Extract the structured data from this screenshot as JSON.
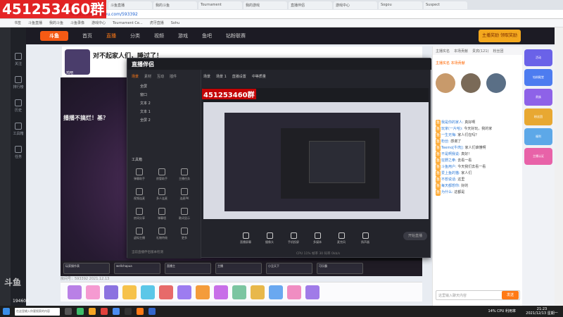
{
  "overlay_number": "451253460群",
  "browser": {
    "tabs": [
      "斗鱼",
      "斗鱼直播",
      "我的斗鱼",
      "Tournament",
      "我的游戏",
      "直播伴侣",
      "游戏中心",
      "Sogou",
      "Suspect"
    ],
    "url": "https://www.douyu.com/593392",
    "bookmarks": [
      "书签",
      "斗鱼直播",
      "我的斗鱼",
      "斗鱼录像",
      "游戏中心",
      "Tournament Ce...",
      "虎牙直播",
      "Sohu"
    ]
  },
  "sidebar": {
    "items": [
      "关注",
      "排行榜",
      "历史",
      "工具箱",
      "任务"
    ]
  },
  "topnav": {
    "logo": "斗鱼",
    "items": [
      "首页",
      "直播",
      "分类",
      "视频",
      "游戏",
      "鱼吧",
      "钻粉联赛"
    ],
    "promo": "主播奖励 领取奖励"
  },
  "room": {
    "title": "对不起家人们，睡过了！",
    "streamer": "鸡吧",
    "stream_caption": "播播不搞烂！基？",
    "room_id_text": "房间号：593392  2021.12.13"
  },
  "obs": {
    "title": "直播伴侣",
    "tabs": [
      "场景",
      "素材",
      "互动",
      "插件"
    ],
    "scene_items": [
      "全屏",
      "窗口",
      "文本 2",
      "文本 1",
      "全屏 2"
    ],
    "tools_label": "工具箱",
    "tools": [
      "弹幕助手",
      "房管助手",
      "主播任务",
      "视频连麦",
      "多人连麦",
      "连麦PK",
      "房间分享",
      "弹幕墙",
      "歌词显示",
      "虚拟主播",
      "礼物特效",
      "更多"
    ],
    "scene_header": [
      "场景",
      "场景 1",
      "直播设置",
      "中等质量"
    ],
    "buttons": [
      "直播屏幕",
      "摄像头",
      "手机投屏",
      "多媒体",
      "麦克风",
      "扬声器"
    ],
    "start_label": "开始直播",
    "footer": "当前直播伴侣版本检测",
    "status": "CPU 11%  帧率 30  码率 0kb/s"
  },
  "game_cards": [
    "玩家操作表",
    "wellchapua",
    "直播主",
    "主播",
    "小丑天下",
    "可乐霸"
  ],
  "right_panel": {
    "tabs": [
      "主播实名",
      "本场贡献",
      "贵宾(121)",
      "粉丝团"
    ],
    "ranking": "主播实名  本场贡献",
    "chat": [
      {
        "tag": "鱼",
        "user": "我是你的家人:",
        "text": "真好啊"
      },
      {
        "tag": "鱼",
        "user": "玩家(一片哈):",
        "text": "今天好玩，我的家"
      },
      {
        "tag": "鱼",
        "user": "一生无悔:",
        "text": "家人们在吗？"
      },
      {
        "tag": "鱼",
        "user": "粉丝:",
        "text": "感谢了"
      },
      {
        "tag": "鱼",
        "user": "Teemo[牛肉]:",
        "text": "家人们谁懂啊"
      },
      {
        "tag": "鱼",
        "user": "不是啊我说:",
        "text": "真好！"
      },
      {
        "tag": "鱼",
        "user": "狂野之拳:",
        "text": "去看一看"
      },
      {
        "tag": "鱼",
        "user": "斗鱼用户:",
        "text": "今天我们去看一看"
      },
      {
        "tag": "鱼",
        "user": "爱上鱼的猫:",
        "text": "家人们"
      },
      {
        "tag": "鱼",
        "user": "不想说话:",
        "text": "这里"
      },
      {
        "tag": "鱼",
        "user": "每天都想你:",
        "text": "好的"
      },
      {
        "tag": "鱼",
        "user": "为什么:",
        "text": "这都是"
      }
    ],
    "input_placeholder": "这里输入聊天内容",
    "send_label": "发送"
  },
  "far_right": {
    "promos": [
      "活动",
      "钻粉殿堂",
      "贵族",
      "粉丝团",
      "福利",
      "主播认证"
    ]
  },
  "taskbar": {
    "search_placeholder": "在这里输入你要搜索的内容",
    "cpu": "14%\nCPU 利用率",
    "time": "21:23",
    "date": "2021/12/13 星期一"
  },
  "watermark": "斗鱼",
  "watermark_num": "194603"
}
